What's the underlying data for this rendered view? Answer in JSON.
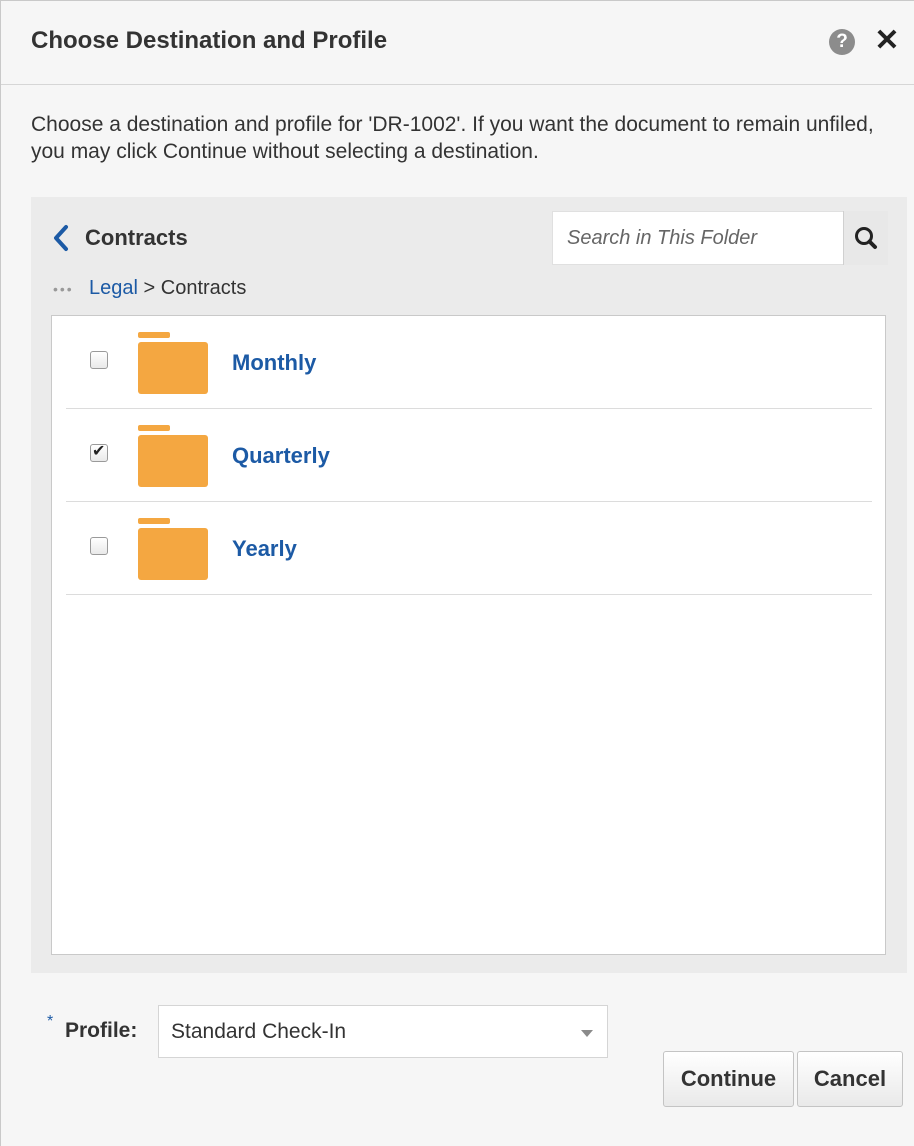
{
  "dialog": {
    "title": "Choose Destination and Profile",
    "instructions": "Choose a destination and profile for 'DR-1002'. If you want the document to remain unfiled, you may click Continue without selecting a destination."
  },
  "browser": {
    "current_folder": "Contracts",
    "search": {
      "placeholder": "Search in This Folder",
      "value": ""
    },
    "breadcrumb": {
      "ellipsis": "•••",
      "parent": "Legal",
      "separator": ">",
      "current": "Contracts"
    },
    "folders": [
      {
        "name": "Monthly",
        "checked": false
      },
      {
        "name": "Quarterly",
        "checked": true
      },
      {
        "name": "Yearly",
        "checked": false
      }
    ]
  },
  "profile": {
    "required_marker": "*",
    "label": "Profile:",
    "selected": "Standard Check-In"
  },
  "buttons": {
    "continue": "Continue",
    "cancel": "Cancel"
  },
  "colors": {
    "link": "#1c5aa5",
    "folder": "#f4a741",
    "panel_bg": "#ebebeb",
    "dialog_bg": "#f6f6f6"
  },
  "icons": {
    "help": "help-circle-icon",
    "close": "close-icon",
    "back": "chevron-left-icon",
    "search": "search-icon",
    "folder": "folder-icon"
  }
}
